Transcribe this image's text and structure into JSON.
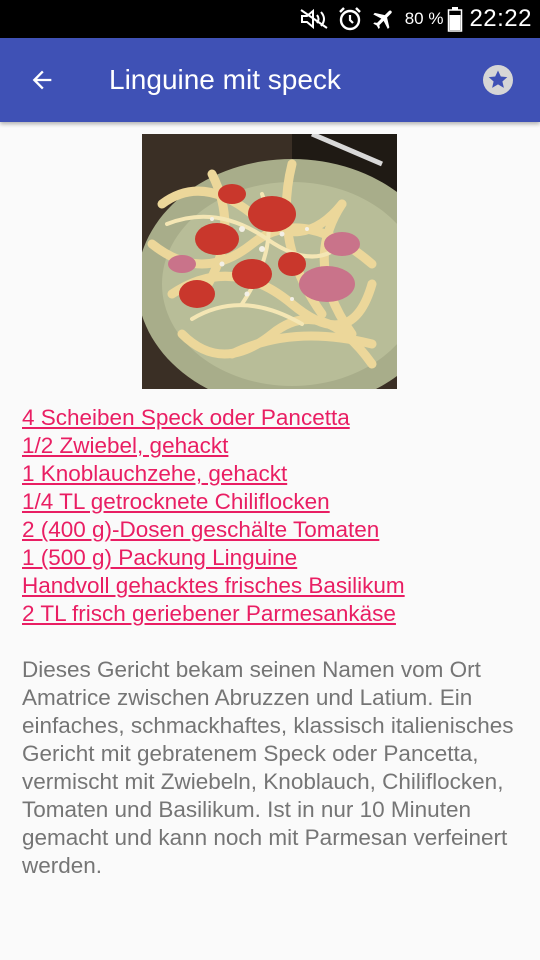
{
  "status_bar": {
    "icons": [
      "mute-icon",
      "alarm-icon",
      "airplane-mode-icon"
    ],
    "battery_percent": "80 %",
    "time": "22:22"
  },
  "app_bar": {
    "title": "Linguine mit speck",
    "background_color": "#3f51b5"
  },
  "recipe": {
    "image_alt": "Linguine mit speck",
    "ingredients": [
      "4 Scheiben Speck oder Pancetta",
      "1/2 Zwiebel, gehackt",
      "1 Knoblauchzehe, gehackt",
      "1/4 TL getrocknete Chiliflocken",
      "2 (400 g)-Dosen geschälte Tomaten",
      "1 (500 g) Packung Linguine",
      "Handvoll gehacktes frisches Basilikum",
      "2 TL frisch geriebener Parmesankäse"
    ],
    "description": "Dieses Gericht bekam seinen Namen vom Ort Amatrice zwischen Abruzzen und Latium. Ein einfaches, schmackhaftes, klassisch italienisches Gericht mit gebratenem Speck oder Pancetta, vermischt mit Zwiebeln, Knoblauch, Chiliflocken, Tomaten und Basilikum. Ist in nur 10 Minuten gemacht und kann noch mit Parmesan verfeinert werden.",
    "link_color": "#e91e63",
    "text_color": "#757575"
  }
}
